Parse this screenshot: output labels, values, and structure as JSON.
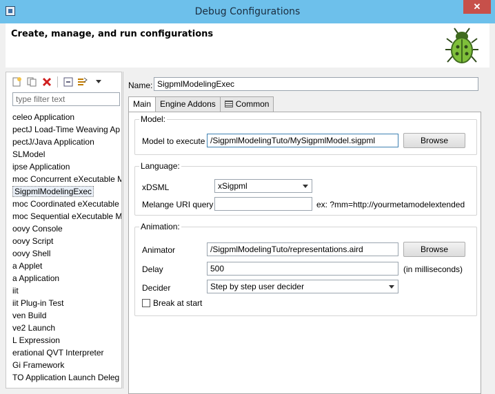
{
  "window": {
    "title": "Debug Configurations",
    "close_glyph": "✕"
  },
  "header": {
    "subtitle": "Create, manage, and run configurations"
  },
  "sidebar": {
    "filter_placeholder": "type filter text",
    "items": [
      "celeo Application",
      "pectJ Load-Time Weaving Ap",
      "pectJ/Java Application",
      "SLModel",
      "ipse Application",
      "moc Concurrent eXecutable M",
      "SigpmlModelingExec",
      "moc Coordinated eXecutable",
      "moc Sequential eXecutable M",
      "oovy Console",
      "oovy Script",
      "oovy Shell",
      "a Applet",
      "a Application",
      "iit",
      "iit Plug-in Test",
      "ven Build",
      "ve2 Launch",
      "L Expression",
      "erational QVT Interpreter",
      "Gi Framework",
      "TO Application Launch Deleg"
    ],
    "selected_index": 6
  },
  "config": {
    "name_label": "Name:",
    "name_value": "SigpmlModelingExec",
    "tabs": {
      "main": "Main",
      "engine_addons": "Engine Addons",
      "common": "Common"
    },
    "model": {
      "group_title": "Model:",
      "label": "Model to execute",
      "value": "/SigpmlModelingTuto/MySigpmlModel.sigpml",
      "browse": "Browse"
    },
    "language": {
      "group_title": "Language:",
      "xdsml_label": "xDSML",
      "xdsml_value": "xSigpml",
      "melange_label": "Melange URI query",
      "melange_value": "",
      "melange_hint": "ex: ?mm=http://yourmetamodelextended"
    },
    "animation": {
      "group_title": "Animation:",
      "animator_label": "Animator",
      "animator_value": "/SigpmlModelingTuto/representations.aird",
      "browse": "Browse",
      "delay_label": "Delay",
      "delay_value": "500",
      "delay_hint": "(in milliseconds)",
      "decider_label": "Decider",
      "decider_value": "Step by step user decider",
      "break_label": "Break at start",
      "break_checked": false
    }
  },
  "colors": {
    "titlebar": "#6dc0eb",
    "close": "#c7504a",
    "focus_border": "#3c7fb1"
  }
}
